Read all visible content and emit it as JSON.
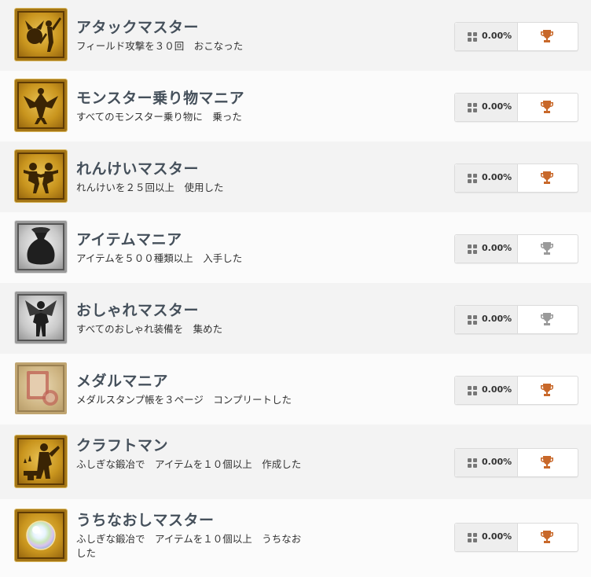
{
  "trophies": [
    {
      "title": "アタックマスター",
      "description": "フィールド攻撃を３０回　おこなった",
      "icon": "warrior-attack-icon",
      "frame": "gold",
      "percent": "0.00%",
      "trophy_grade": "bronze",
      "trophy_color": "#c8682a"
    },
    {
      "title": "モンスター乗り物マニア",
      "description": "すべてのモンスター乗り物に　乗った",
      "icon": "dragon-rider-icon",
      "frame": "gold",
      "percent": "0.00%",
      "trophy_grade": "bronze",
      "trophy_color": "#c8682a"
    },
    {
      "title": "れんけいマスター",
      "description": "れんけいを２５回以上　使用した",
      "icon": "combo-duo-icon",
      "frame": "gold",
      "percent": "0.00%",
      "trophy_grade": "bronze",
      "trophy_color": "#c8682a"
    },
    {
      "title": "アイテムマニア",
      "description": "アイテムを５００種類以上　入手した",
      "icon": "item-bag-icon",
      "frame": "silver",
      "percent": "0.00%",
      "trophy_grade": "silver",
      "trophy_color": "#9a9a9a"
    },
    {
      "title": "おしゃれマスター",
      "description": "すべてのおしゃれ装備を　集めた",
      "icon": "fashion-figure-icon",
      "frame": "silver",
      "percent": "0.00%",
      "trophy_grade": "silver",
      "trophy_color": "#9a9a9a"
    },
    {
      "title": "メダルマニア",
      "description": "メダルスタンプ帳を３ページ　コンプリートした",
      "icon": "medal-stamp-book-icon",
      "frame": "bronze",
      "percent": "0.00%",
      "trophy_grade": "bronze",
      "trophy_color": "#c8682a"
    },
    {
      "title": "クラフトマン",
      "description": "ふしぎな鍛冶で　アイテムを１０個以上　作成した",
      "icon": "blacksmith-icon",
      "frame": "gold",
      "percent": "0.00%",
      "trophy_grade": "bronze",
      "trophy_color": "#c8682a"
    },
    {
      "title": "うちなおしマスター",
      "description": "ふしぎな鍛冶で　アイテムを１０個以上　うちなおした",
      "icon": "rainbow-orb-icon",
      "frame": "gold",
      "percent": "0.00%",
      "trophy_grade": "bronze",
      "trophy_color": "#c8682a"
    }
  ]
}
